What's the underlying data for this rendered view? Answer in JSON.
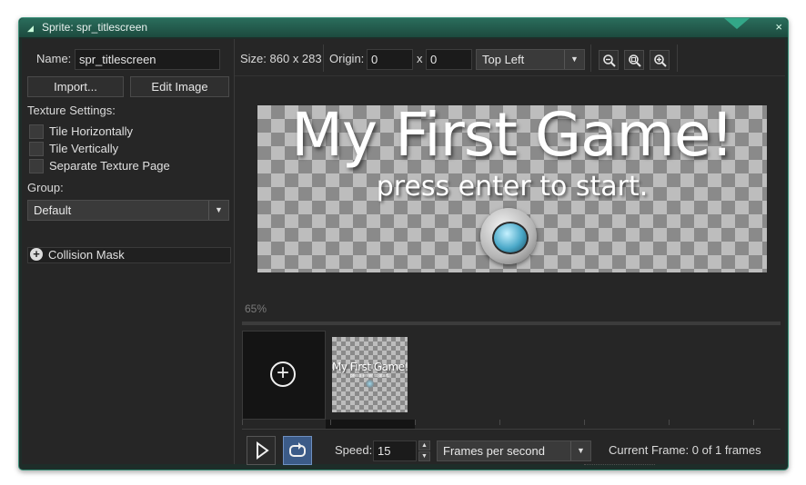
{
  "window": {
    "title": "Sprite: spr_titlescreen",
    "close_glyph": "×",
    "collapse_glyph": "◢"
  },
  "left": {
    "name_label": "Name:",
    "name_value": "spr_titlescreen",
    "import_label": "Import...",
    "edit_image_label": "Edit Image",
    "texture_settings_label": "Texture Settings:",
    "tile_horizontally": {
      "label": "Tile Horizontally",
      "checked": false
    },
    "tile_vertically": {
      "label": "Tile Vertically",
      "checked": false
    },
    "separate_texture_page": {
      "label": "Separate Texture Page",
      "checked": false
    },
    "group_label": "Group:",
    "group_value": "Default",
    "collision_mask_label": "Collision Mask"
  },
  "toolbar": {
    "size_text": "Size: 860 x 283",
    "origin_label": "Origin:",
    "origin_x": "0",
    "origin_x_sep": "x",
    "origin_y": "0",
    "origin_preset": "Top Left",
    "zoom_icons": [
      "zoom-out-icon",
      "zoom-reset-icon",
      "zoom-in-icon"
    ]
  },
  "preview": {
    "title_text": "My First Game!",
    "subtitle_text": "press enter to start.",
    "zoom_text": "65%"
  },
  "frames": {
    "thumb_title": "My First Game!",
    "thumb_sub": "press enter to start."
  },
  "playback": {
    "speed_label": "Speed:",
    "speed_value": "15",
    "speed_unit": "Frames per second",
    "current_frame_text": "Current Frame: 0 of 1 frames"
  },
  "colors": {
    "accent": "#2f9f82",
    "loop_active": "#3c5b88"
  }
}
